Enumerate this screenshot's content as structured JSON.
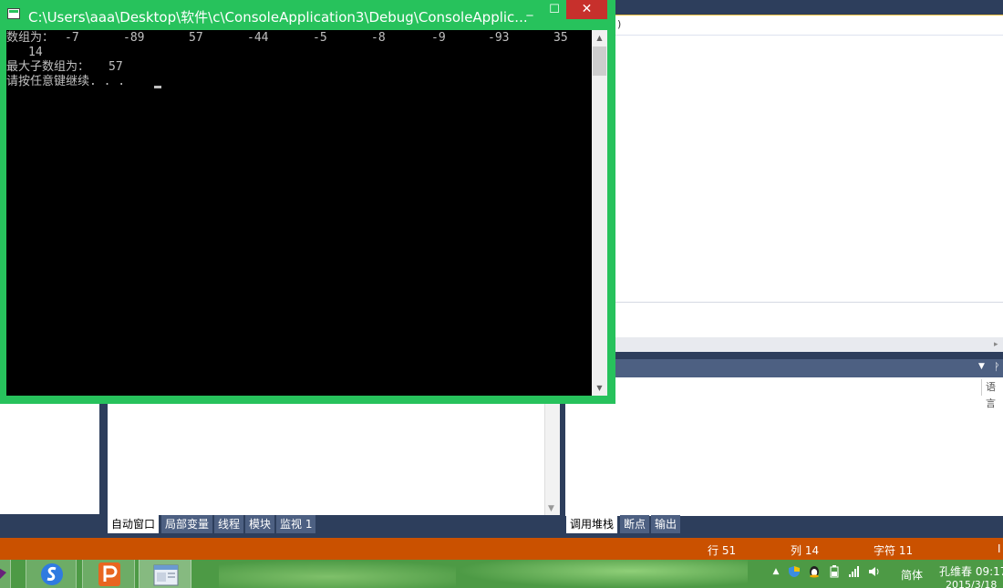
{
  "console": {
    "title": "C:\\Users\\aaa\\Desktop\\软件\\c\\ConsoleApplication3\\Debug\\ConsoleApplic...",
    "minimize": "_",
    "maximize": "☐",
    "close": "✕",
    "array_label": "数组为：",
    "array_values": [
      "-7",
      "-89",
      "57",
      "-44",
      "-5",
      "-8",
      "-9",
      "-93",
      "35",
      "14"
    ],
    "max_label": "最大子数组为：",
    "max_value": "57",
    "prompt": "请按任意键继续. . ."
  },
  "ide": {
    "tab_fragment": ")",
    "right_column_header": "语言",
    "left_tabs": [
      "自动窗口",
      "局部变量",
      "线程",
      "模块",
      "监视 1"
    ],
    "right_tabs": [
      "调用堆栈",
      "断点",
      "输出"
    ],
    "status": {
      "line": "行 51",
      "col": "列 14",
      "char": "字符 11",
      "ins": "I"
    },
    "right_panel_pin": "ᚹ"
  },
  "taskbar": {
    "lang": "简体",
    "user_time": "孔维春 09:17",
    "date": "2015/3/18",
    "icons": [
      "vs-icon",
      "sogou-browser-icon",
      "wps-presentation-icon",
      "console-window-icon"
    ]
  },
  "colors": {
    "console_border": "#27c25c",
    "status_bar": "#ca5100",
    "ide_dark": "#2d3e5c",
    "close_button": "#c7302c"
  }
}
